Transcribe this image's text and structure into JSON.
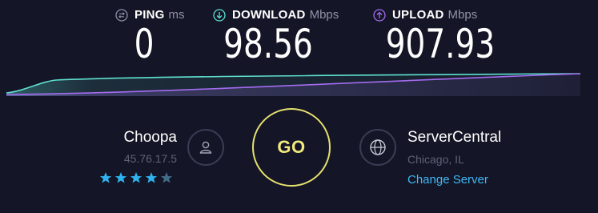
{
  "metrics": {
    "ping": {
      "label": "PING",
      "unit": "ms",
      "value": "0",
      "icon": "ping-icon"
    },
    "download": {
      "label": "DOWNLOAD",
      "unit": "Mbps",
      "value": "98.56",
      "icon": "download-arrow-icon"
    },
    "upload": {
      "label": "UPLOAD",
      "unit": "Mbps",
      "value": "907.93",
      "icon": "upload-arrow-icon"
    }
  },
  "colors": {
    "background": "#141526",
    "download": "#5ee0d0",
    "upload": "#a46cf0",
    "go": "#f1ea7d",
    "link": "#3fb8f5",
    "muted": "#5f6177",
    "star_filled": "#2fb2ee",
    "star_empty": "#3f6c86"
  },
  "isp": {
    "name": "Choopa",
    "ip": "45.76.17.5",
    "rating": 4,
    "rating_max": 5,
    "icon": "user-icon"
  },
  "go_button": {
    "label": "GO"
  },
  "server": {
    "name": "ServerCentral",
    "location": "Chicago, IL",
    "change_label": "Change Server",
    "icon": "globe-icon"
  }
}
